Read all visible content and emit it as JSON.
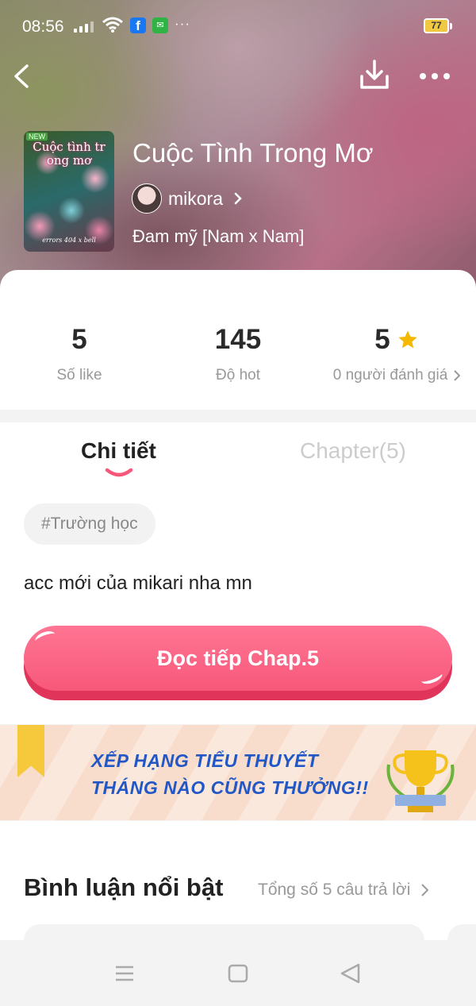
{
  "status_bar": {
    "time": "08:56",
    "battery": "77",
    "notification_icons": [
      "facebook-icon",
      "wechat-icon"
    ],
    "overflow": "···"
  },
  "header": {
    "back_icon": "chevron-left-icon",
    "download_icon": "download-icon",
    "more_icon": "more-horizontal-icon"
  },
  "story": {
    "title": "Cuộc Tình Trong Mơ",
    "cover": {
      "badge": "NEW",
      "title": "Cuộc tình tr ong mơ",
      "author": "errors 404 x bell"
    },
    "author": "mikora",
    "genre": "Đam mỹ [Nam x Nam]"
  },
  "stats": [
    {
      "value": "5",
      "label": "Số like"
    },
    {
      "value": "145",
      "label": "Độ hot"
    },
    {
      "value": "5",
      "label": "0 người đánh giá"
    }
  ],
  "tabs": [
    {
      "label": "Chi tiết",
      "active": true
    },
    {
      "label": "Chapter(5)",
      "active": false
    }
  ],
  "tag": "#Trường học",
  "description": "acc mới của mikari nha mn",
  "read_button": "Đọc tiếp Chap.5",
  "banner": {
    "line1": "XẾP HẠNG TIỂU THUYẾT",
    "line2": "THÁNG NÀO CŨNG THƯỞNG!!"
  },
  "comments": {
    "title": "Bình luận nổi bật",
    "total": "Tổng số 5 câu trả lời"
  },
  "colors": {
    "accent": "#f7587a",
    "star": "#f5b800",
    "banner_text": "#2257c6"
  }
}
